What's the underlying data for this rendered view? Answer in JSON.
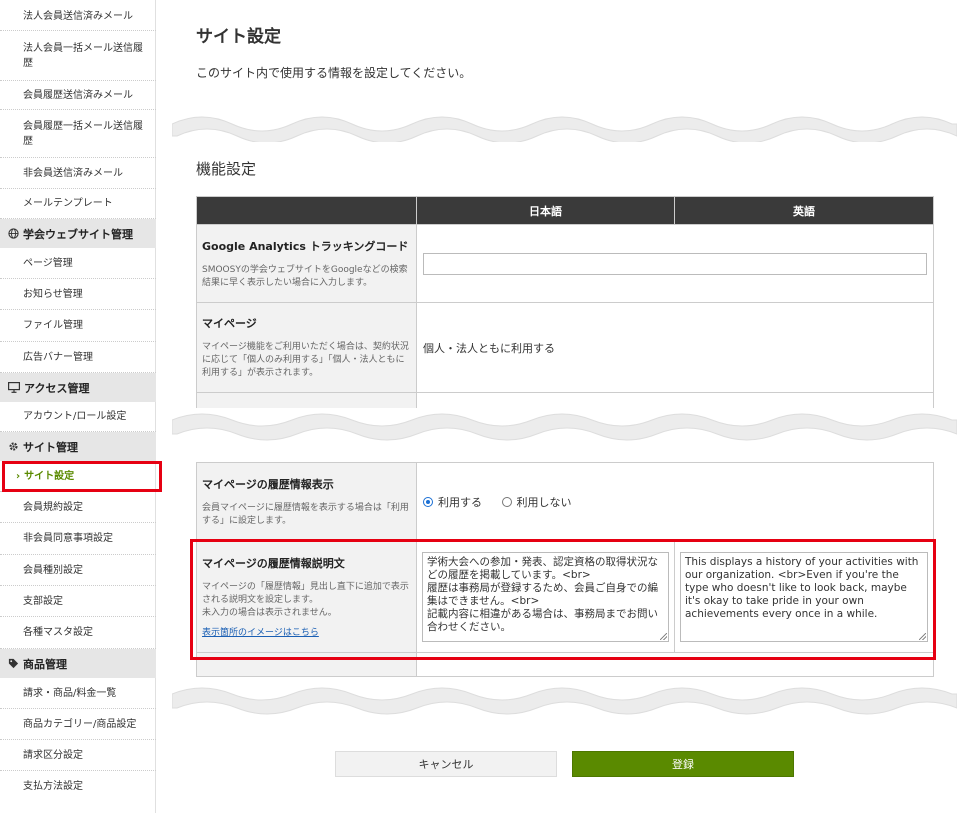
{
  "sidebar": {
    "items_top": [
      "法人会員送信済みメール",
      "法人会員一括メール送信履歴",
      "会員履歴送信済みメール",
      "会員履歴一括メール送信履歴",
      "非会員送信済みメール",
      "メールテンプレート"
    ],
    "section_web": "学会ウェブサイト管理",
    "items_web": [
      "ページ管理",
      "お知らせ管理",
      "ファイル管理",
      "広告バナー管理"
    ],
    "section_access": "アクセス管理",
    "items_access": [
      "アカウント/ロール設定"
    ],
    "section_site": "サイト管理",
    "active_item": "サイト設定",
    "items_site": [
      "会員規約設定",
      "非会員同意事項設定",
      "会員種別設定",
      "支部設定",
      "各種マスタ設定"
    ],
    "section_product": "商品管理",
    "items_product": [
      "請求・商品/料金一覧",
      "商品カテゴリー/商品設定",
      "請求区分設定",
      "支払方法設定"
    ]
  },
  "main": {
    "title": "サイト設定",
    "description": "このサイト内で使用する情報を設定してください。",
    "section_title": "機能設定",
    "columns": {
      "ja": "日本語",
      "en": "英語"
    },
    "ga": {
      "label": "Google Analytics トラッキングコード",
      "desc": "SMOOSYの学会ウェブサイトをGoogleなどの検索結果に早く表示したい場合に入力します。",
      "value": ""
    },
    "mypage": {
      "label": "マイページ",
      "desc": "マイページ機能をご利用いただく場合は、契約状況に応じて「個人のみ利用する」「個人・法人ともに利用する」が表示されます。",
      "value": "個人・法人ともに利用する"
    },
    "history_display": {
      "label": "マイページの履歴情報表示",
      "desc": "会員マイページに履歴情報を表示する場合は「利用する」に設定します。",
      "opt_use": "利用する",
      "opt_no": "利用しない"
    },
    "history_desc": {
      "label": "マイページの履歴情報説明文",
      "desc": "マイページの「履歴情報」見出し直下に追加で表示される説明文を設定します。\n未入力の場合は表示されません。",
      "link": "表示箇所のイメージはこちら",
      "value_ja": "学術大会への参加・発表、認定資格の取得状況などの履歴を掲載しています。<br>\n履歴は事務局が登録するため、会員ご自身での編集はできません。<br>\n記載内容に相違がある場合は、事務局までお問い合わせください。",
      "value_en": "This displays a history of your activities with our organization. <br>Even if you're the type who doesn't like to look back, maybe it's okay to take pride in your own achievements every once in a while."
    },
    "buttons": {
      "cancel": "キャンセル",
      "submit": "登録"
    }
  },
  "colors": {
    "accent": "#5a8a00",
    "highlight": "#e60012",
    "header": "#3a3a3a"
  }
}
